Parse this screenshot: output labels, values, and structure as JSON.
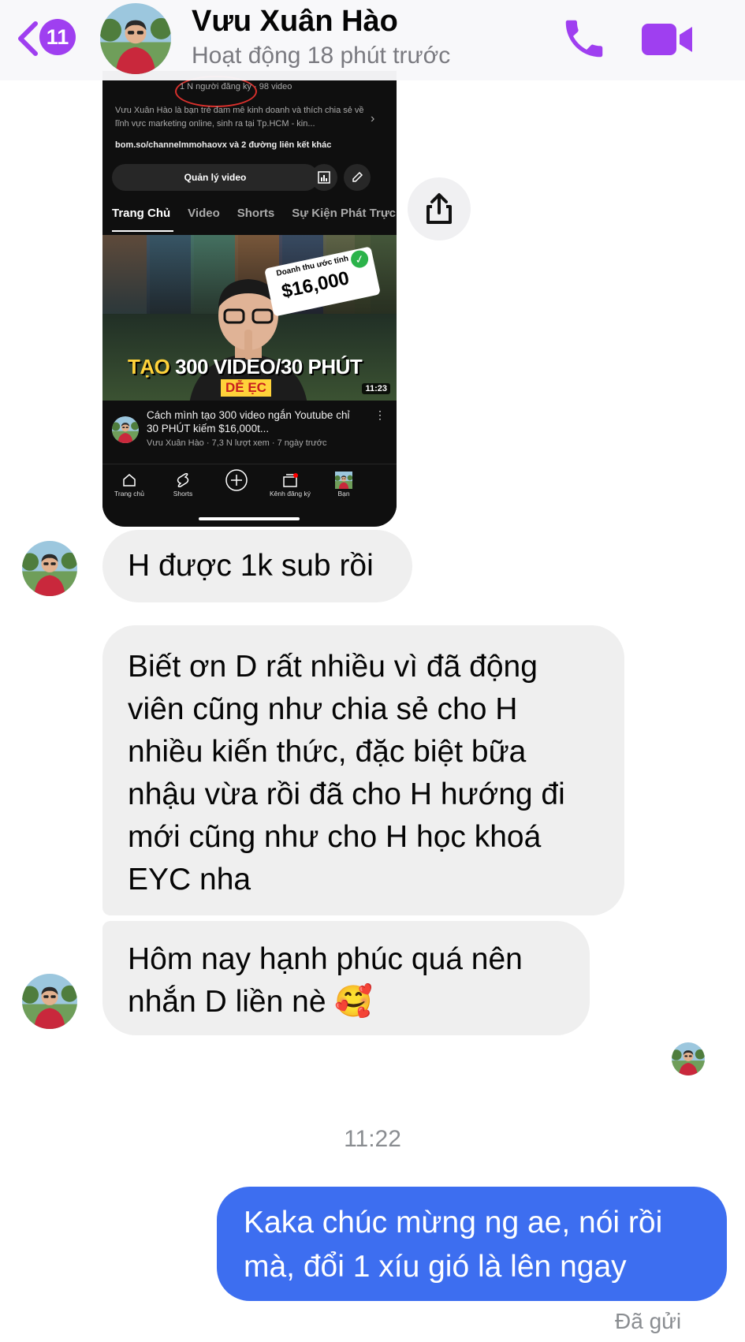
{
  "header": {
    "unread_count": "11",
    "contact_name": "Vưu Xuân Hào",
    "contact_status": "Hoạt động 18 phút trước",
    "accent_color": "#9f3ff0",
    "call_icon": "phone-icon",
    "video_icon": "video-camera-icon"
  },
  "shared_image": {
    "subscribers": "1 N người đăng ký · 98 video",
    "description": "Vưu Xuân Hào là bạn trẻ đam mê kinh doanh và thích chia sẻ về lĩnh vực marketing online, sinh ra tại Tp.HCM - kin...",
    "links": "bom.so/channelmmohaovx và 2 đường liên kết khác",
    "manage_button": "Quản lý video",
    "tabs": [
      "Trang Chủ",
      "Video",
      "Shorts",
      "Sự Kiện Phát Trực"
    ],
    "thumb_price_label": "Doanh thu ước tính",
    "thumb_price": "$16,000",
    "thumb_headline_a": "TẠO",
    "thumb_headline_b": " 300 VIDEO/30 PHÚT",
    "thumb_tag": "DỄ ẸC",
    "duration": "11:23",
    "video_title": "Cách mình tạo 300 video ngắn Youtube chỉ 30 PHÚT kiếm $16,000t...",
    "video_stats": "Vưu Xuân Hào · 7,3 N lượt xem · 7 ngày trước",
    "nav": [
      "Trang chủ",
      "Shorts",
      "",
      "Kênh đăng ký",
      "Bạn"
    ]
  },
  "messages": {
    "m1": "H được 1k sub rồi",
    "m2": "Biết ơn D rất nhiều vì đã động viên cũng như chia sẻ cho H nhiều kiến thức, đặc biệt bữa nhậu vừa rồi đã cho H hướng đi mới cũng như cho H học khoá EYC nha",
    "m3": "Hôm nay hạnh phúc quá nên nhắn D liền nè 🥰",
    "time": "11:22",
    "sent": "Kaka chúc mừng ng ae, nói rồi mà, đổi 1 xíu gió là lên ngay",
    "sent_status": "Đã gửi",
    "sent_color": "#3d6ef0"
  }
}
